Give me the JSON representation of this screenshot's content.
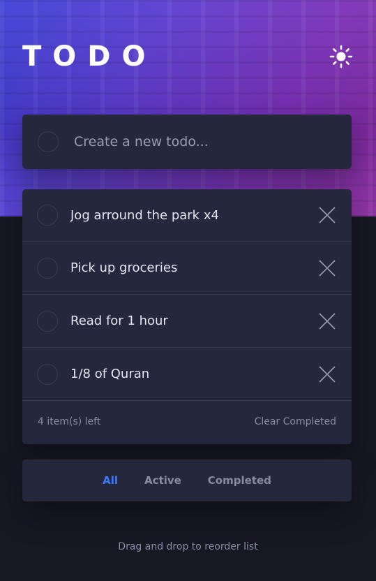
{
  "app": {
    "title": "TODO",
    "theme_icon": "sun-icon"
  },
  "new_todo": {
    "placeholder": "Create a new todo..."
  },
  "todos": [
    {
      "text": "Jog arround the park x4",
      "completed": false
    },
    {
      "text": "Pick up groceries",
      "completed": false
    },
    {
      "text": "Read for 1 hour",
      "completed": false
    },
    {
      "text": "1/8 of Quran",
      "completed": false
    }
  ],
  "footer": {
    "items_left": "4 item(s) left",
    "clear_label": "Clear Completed"
  },
  "filters": [
    {
      "label": "All",
      "active": true
    },
    {
      "label": "Active",
      "active": false
    },
    {
      "label": "Completed",
      "active": false
    }
  ],
  "hint": "Drag and drop to reorder list",
  "colors": {
    "background": "#181824",
    "card": "#25273d",
    "accent": "#3a7bfd",
    "text": "#e4e5f1",
    "muted": "#8a8ca3"
  }
}
